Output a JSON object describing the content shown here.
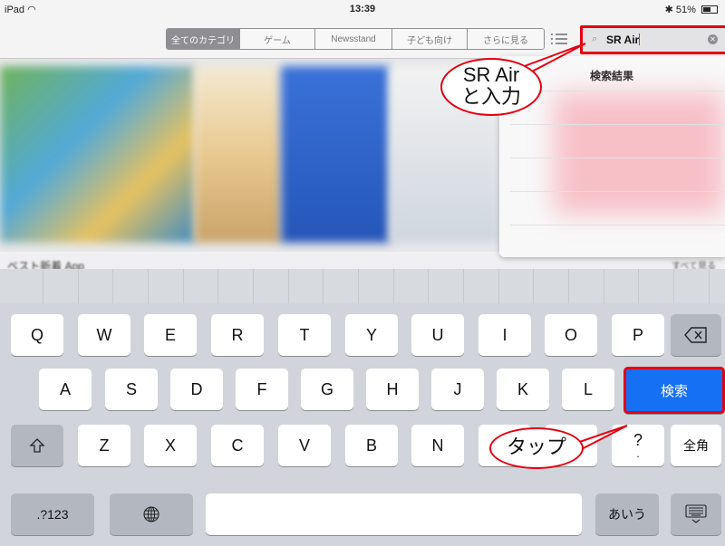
{
  "status": {
    "device": "iPad",
    "time": "13:39",
    "battery": "51%"
  },
  "nav": {
    "segments": [
      "全てのカテゴリ",
      "ゲーム",
      "Newsstand",
      "子ども向け",
      "さらに見る"
    ],
    "search_value": "SR Air"
  },
  "content": {
    "section_title": "ベスト新着 App",
    "more": "すべて見る"
  },
  "results": {
    "title": "検索結果"
  },
  "callouts": {
    "type_line1": "SR Air",
    "type_line2": "と入力",
    "tap": "タップ"
  },
  "keyboard": {
    "row1": [
      "Q",
      "W",
      "E",
      "R",
      "T",
      "Y",
      "U",
      "I",
      "O",
      "P"
    ],
    "row2": [
      "A",
      "S",
      "D",
      "F",
      "G",
      "H",
      "J",
      "K",
      "L"
    ],
    "row3": [
      "Z",
      "X",
      "C",
      "V",
      "B",
      "N",
      "M"
    ],
    "search_key": "検索",
    "question_key": "?",
    "zenkaku_key": "全角",
    "numbers_key": ".?123",
    "kana_key": "あいう"
  },
  "colors": {
    "annotation_red": "#e60012",
    "search_key_blue": "#1670f4"
  },
  "icons": [
    "wifi-icon",
    "bluetooth-icon",
    "battery-icon",
    "list-icon",
    "search-icon",
    "clear-icon",
    "backspace-icon",
    "shift-icon",
    "globe-icon",
    "keyboard-dismiss-icon"
  ]
}
